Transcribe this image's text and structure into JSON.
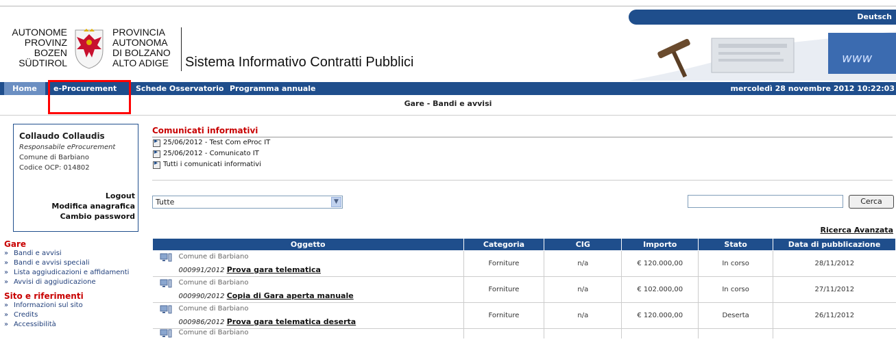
{
  "language_link": "Deutsch",
  "logo": {
    "de_lines": [
      "AUTONOME",
      "PROVINZ",
      "BOZEN",
      "SÜDTIROL"
    ],
    "it_lines": [
      "PROVINCIA",
      "AUTONOMA",
      "DI BOLZANO",
      "ALTO ADIGE"
    ]
  },
  "app_title": "Sistema Informativo Contratti Pubblici",
  "nav": {
    "items": [
      "Home",
      "e-Procurement",
      "Schede Osservatorio",
      "Programma annuale"
    ],
    "datetime": "mercoledì 28 novembre 2012 10:22:03"
  },
  "subheader": "Gare - Bandi e avvisi",
  "user": {
    "name": "Collaudo Collaudis",
    "role": "Responsabile eProcurement",
    "org": "Comune di Barbiano",
    "code": "Codice OCP: 014802",
    "links": [
      "Logout",
      "Modifica anagrafica",
      "Cambio password"
    ]
  },
  "leftnav": {
    "gare_title": "Gare",
    "gare_items": [
      "Bandi e avvisi",
      "Bandi e avvisi speciali",
      "Lista aggiudicazioni e affidamenti",
      "Avvisi di aggiudicazione"
    ],
    "sito_title": "Sito e riferimenti",
    "sito_items": [
      "Informazioni sul sito",
      "Credits",
      "Accessibilità"
    ]
  },
  "comunicati": {
    "title": "Comunicati informativi",
    "items": [
      "25/06/2012 - Test Com eProc IT",
      "25/06/2012 - Comunicato IT",
      "Tutti i comunicati informativi"
    ]
  },
  "filter": {
    "selected": "Tutte",
    "search_value": "",
    "search_button": "Cerca",
    "advanced": "Ricerca Avanzata"
  },
  "table": {
    "headers": [
      "Oggetto",
      "Categoria",
      "CIG",
      "Importo",
      "Stato",
      "Data di pubblicazione"
    ],
    "rows": [
      {
        "ente": "Comune di Barbiano",
        "num": "000991/2012",
        "title": "Prova gara telematica",
        "categoria": "Forniture",
        "cig": "n/a",
        "importo": "€ 120.000,00",
        "stato": "In corso",
        "data": "28/11/2012"
      },
      {
        "ente": "Comune di Barbiano",
        "num": "000990/2012",
        "title": "Copia di Gara aperta manuale",
        "categoria": "Forniture",
        "cig": "n/a",
        "importo": "€ 102.000,00",
        "stato": "In corso",
        "data": "27/11/2012"
      },
      {
        "ente": "Comune di Barbiano",
        "num": "000986/2012",
        "title": "Prova gara telematica deserta",
        "categoria": "Forniture",
        "cig": "n/a",
        "importo": "€ 120.000,00",
        "stato": "Deserta",
        "data": "26/11/2012"
      },
      {
        "ente": "Comune di Barbiano"
      }
    ]
  },
  "colors": {
    "nav_blue": "#1f4e8c",
    "section_red": "#c80000",
    "highlight_red": "#ff0000"
  }
}
